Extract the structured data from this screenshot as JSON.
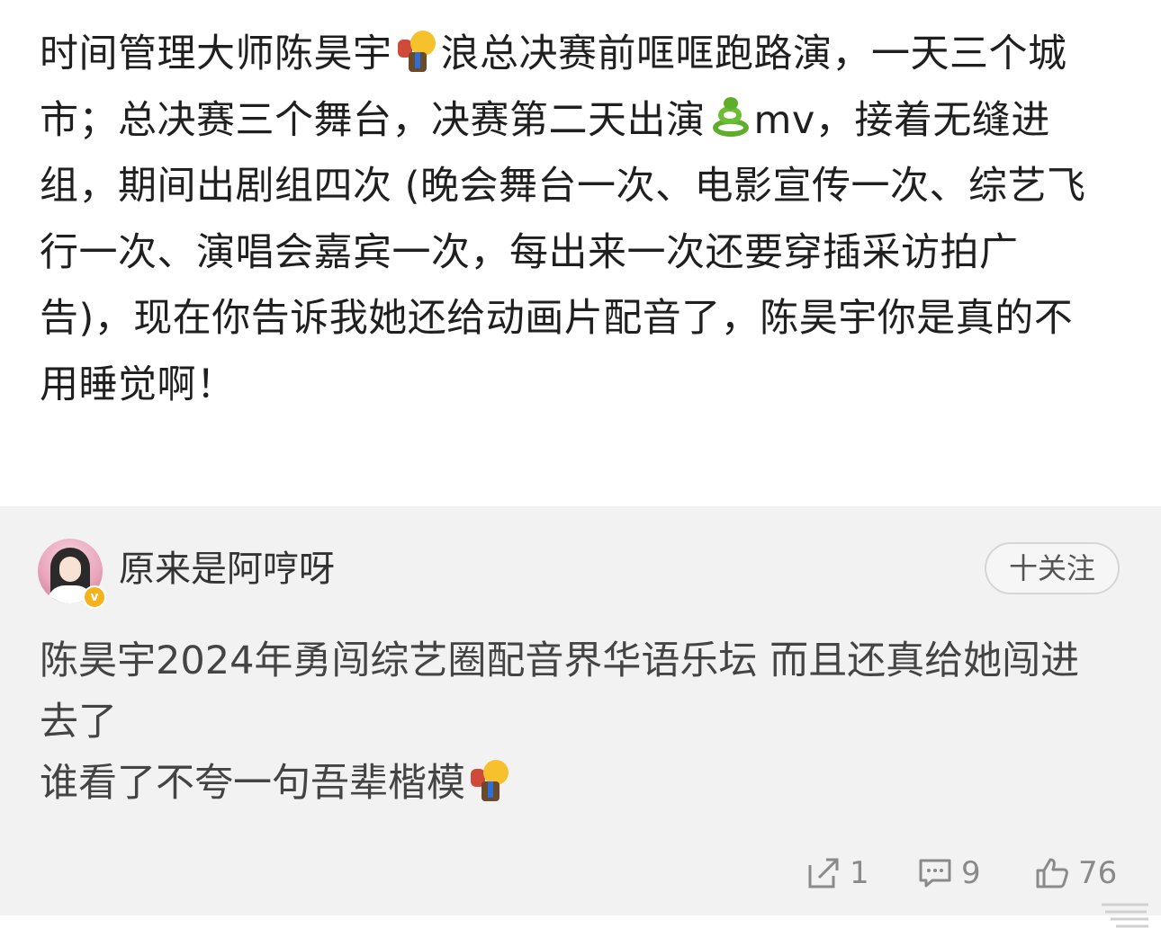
{
  "post": {
    "text_part1": "时间管理大师陈昊宇",
    "emoji1": "person-with-backpack-emoji",
    "text_part2": "浪总决赛前哐哐跑路演，一天三个城市；总决赛三个舞台，决赛第二天出演",
    "emoji2": "snake-emoji",
    "text_part3": "mv，接着无缝进组，期间出剧组四次 (晚会舞台一次、电影宣传一次、综艺飞行一次、演唱会嘉宾一次，每出来一次还要穿插采访拍广告)，现在你告诉我她还给动画片配音了，陈昊宇你是真的不用睡觉啊！"
  },
  "comment": {
    "username": "原来是阿哼呀",
    "verified_badge": "v",
    "follow_label": "十关注",
    "text_line1": "陈昊宇2024年勇闯综艺圈配音界华语乐坛 而且还真给她闯进去了",
    "text_line2": "谁看了不夸一句吾辈楷模",
    "text_emoji": "person-with-backpack-emoji",
    "actions": {
      "share_count": "1",
      "comment_count": "9",
      "like_count": "76"
    }
  },
  "colors": {
    "comment_bg": "#f2f2f2",
    "verified": "#f5b21d"
  }
}
